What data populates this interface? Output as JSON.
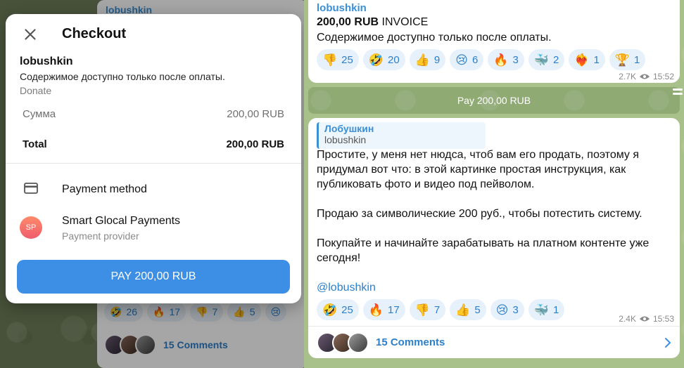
{
  "left_background": {
    "author": "lobushkin",
    "reactions": [
      {
        "emoji": "🤣",
        "count": "26"
      },
      {
        "emoji": "🔥",
        "count": "17"
      },
      {
        "emoji": "👎",
        "count": "7"
      },
      {
        "emoji": "👍",
        "count": "5"
      },
      {
        "emoji": "😢",
        "count": ""
      }
    ],
    "comments_label": "15 Comments"
  },
  "checkout": {
    "title": "Checkout",
    "seller": "lobushkin",
    "description": "Содержимое доступно только после оплаты.",
    "kind": "Donate",
    "sum_label": "Сумма",
    "sum_value": "200,00 RUB",
    "total_label": "Total",
    "total_value": "200,00 RUB",
    "payment_method_label": "Payment method",
    "provider_initials": "SP",
    "provider_name": "Smart Glocal Payments",
    "provider_sub": "Payment provider",
    "pay_button": "PAY 200,00 RUB",
    "icons": {
      "close": "close-icon",
      "card": "credit-card-icon"
    }
  },
  "right": {
    "message1": {
      "author": "lobushkin",
      "amount": "200,00 RUB",
      "invoice_word": "INVOICE",
      "text": "Содержимое доступно только после оплаты.",
      "reactions": [
        {
          "emoji": "👎",
          "count": "25"
        },
        {
          "emoji": "🤣",
          "count": "20"
        },
        {
          "emoji": "👍",
          "count": "9"
        },
        {
          "emoji": "😢",
          "count": "6"
        },
        {
          "emoji": "🔥",
          "count": "3"
        },
        {
          "emoji": "🐳",
          "count": "2"
        },
        {
          "emoji": "❤️‍🔥",
          "count": "1"
        },
        {
          "emoji": "🏆",
          "count": "1"
        }
      ],
      "views": "2.7K",
      "time": "15:52"
    },
    "pay_bar": "Pay 200,00 RUB",
    "message2": {
      "quote_name": "Лобушкин",
      "quote_user": "lobushkin",
      "paragraph1": "Простите, у меня нет нюдса, чтоб вам его продать, поэтому я придумал вот что: в этой картинке простая инструкция, как публиковать фото и видео под пейволом.",
      "paragraph2": "Продаю за символические 200 руб., чтобы потестить систему.",
      "paragraph3": "Покупайте и начинайте зарабатывать на платном контенте уже сегодня!",
      "mention": "@lobushkin",
      "reactions": [
        {
          "emoji": "🤣",
          "count": "25"
        },
        {
          "emoji": "🔥",
          "count": "17"
        },
        {
          "emoji": "👎",
          "count": "7"
        },
        {
          "emoji": "👍",
          "count": "5"
        },
        {
          "emoji": "😢",
          "count": "3"
        },
        {
          "emoji": "🐳",
          "count": "1"
        }
      ],
      "views": "2.4K",
      "time": "15:53"
    },
    "comments_label": "15 Comments"
  },
  "colors": {
    "accent": "#3d8ee5",
    "link": "#2c7fc9",
    "reaction_bg": "#e7f1fb",
    "chat_bg": "#a8c08a"
  }
}
